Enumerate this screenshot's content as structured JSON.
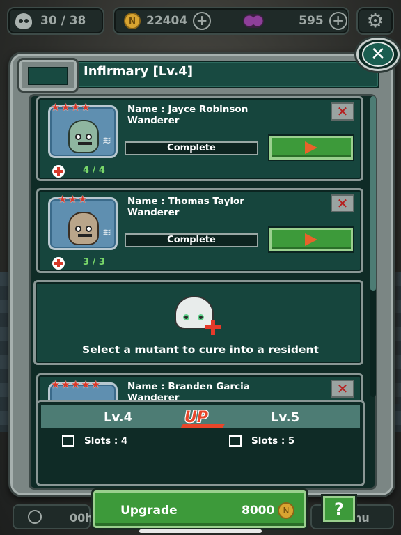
{
  "hud": {
    "population": "30 / 38",
    "coins": "22404",
    "gems": "595",
    "coin_symbol": "N",
    "plus": "+",
    "gear": "⚙"
  },
  "modal": {
    "title": "Infirmary [Lv.4]",
    "close": "✕"
  },
  "patients": [
    {
      "name": "Name : Jayce Robinson",
      "type": "Wanderer",
      "stars": "★★★★",
      "status": "Complete",
      "cure": "4 / 4",
      "skin": "#8fb6a0",
      "delete": "✕"
    },
    {
      "name": "Name : Thomas Taylor",
      "type": "Wanderer",
      "stars": "★★★",
      "status": "Complete",
      "cure": "3 / 3",
      "skin": "#b9a58a",
      "delete": "✕"
    },
    {
      "name": "Name : Branden Garcia",
      "type": "Wanderer",
      "stars": "★★★★★",
      "delete": "✕"
    }
  ],
  "empty_slot": {
    "text": "Select a mutant to cure into a resident"
  },
  "upgrade": {
    "current_level": "Lv.4",
    "next_level": "Lv.5",
    "up_label": "UP",
    "current_slots": "Slots : 4",
    "next_slots": "Slots : 5",
    "button_label": "Upgrade",
    "cost": "8000",
    "help": "?"
  },
  "background": {
    "left_timer_text": "00h",
    "right_menu_text": "nu"
  }
}
